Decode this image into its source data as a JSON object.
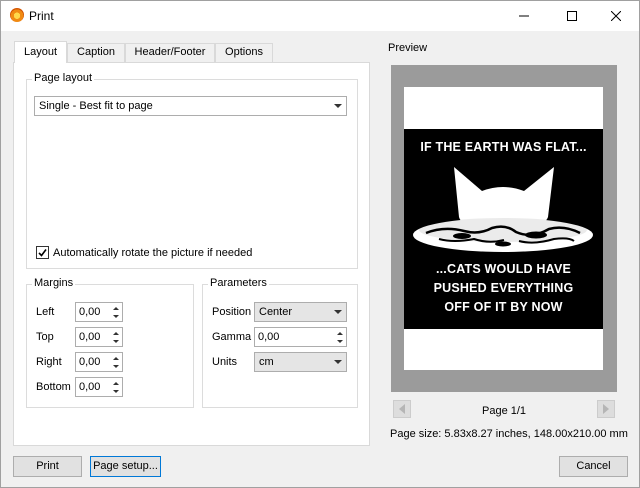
{
  "window": {
    "title": "Print",
    "app_icon": "printer-app-icon",
    "controls": [
      "minimize-icon",
      "maximize-icon",
      "close-icon"
    ]
  },
  "tabs": [
    {
      "label": "Layout",
      "active": true
    },
    {
      "label": "Caption",
      "active": false
    },
    {
      "label": "Header/Footer",
      "active": false
    },
    {
      "label": "Options",
      "active": false
    }
  ],
  "page_layout": {
    "group_label": "Page layout",
    "selected": "Single - Best fit to page",
    "auto_rotate_label": "Automatically rotate the picture if needed",
    "auto_rotate_checked": true
  },
  "margins": {
    "group_label": "Margins",
    "fields": [
      {
        "label": "Left",
        "value": "0,00"
      },
      {
        "label": "Top",
        "value": "0,00"
      },
      {
        "label": "Right",
        "value": "0,00"
      },
      {
        "label": "Bottom",
        "value": "0,00"
      }
    ]
  },
  "parameters": {
    "group_label": "Parameters",
    "position_label": "Position",
    "position_value": "Center",
    "gamma_label": "Gamma",
    "gamma_value": "0,00",
    "units_label": "Units",
    "units_value": "cm"
  },
  "preview": {
    "label": "Preview",
    "image_text_top": "IF THE EARTH WAS FLAT...",
    "image_text_bottom": [
      "...CATS WOULD HAVE",
      "PUSHED EVERYTHING",
      "OFF OF IT BY NOW"
    ],
    "page_indicator": "Page 1/1",
    "page_size": "Page size: 5.83x8.27 inches, 148.00x210.00 mm"
  },
  "buttons": {
    "print": "Print",
    "page_setup": "Page setup...",
    "cancel": "Cancel"
  }
}
